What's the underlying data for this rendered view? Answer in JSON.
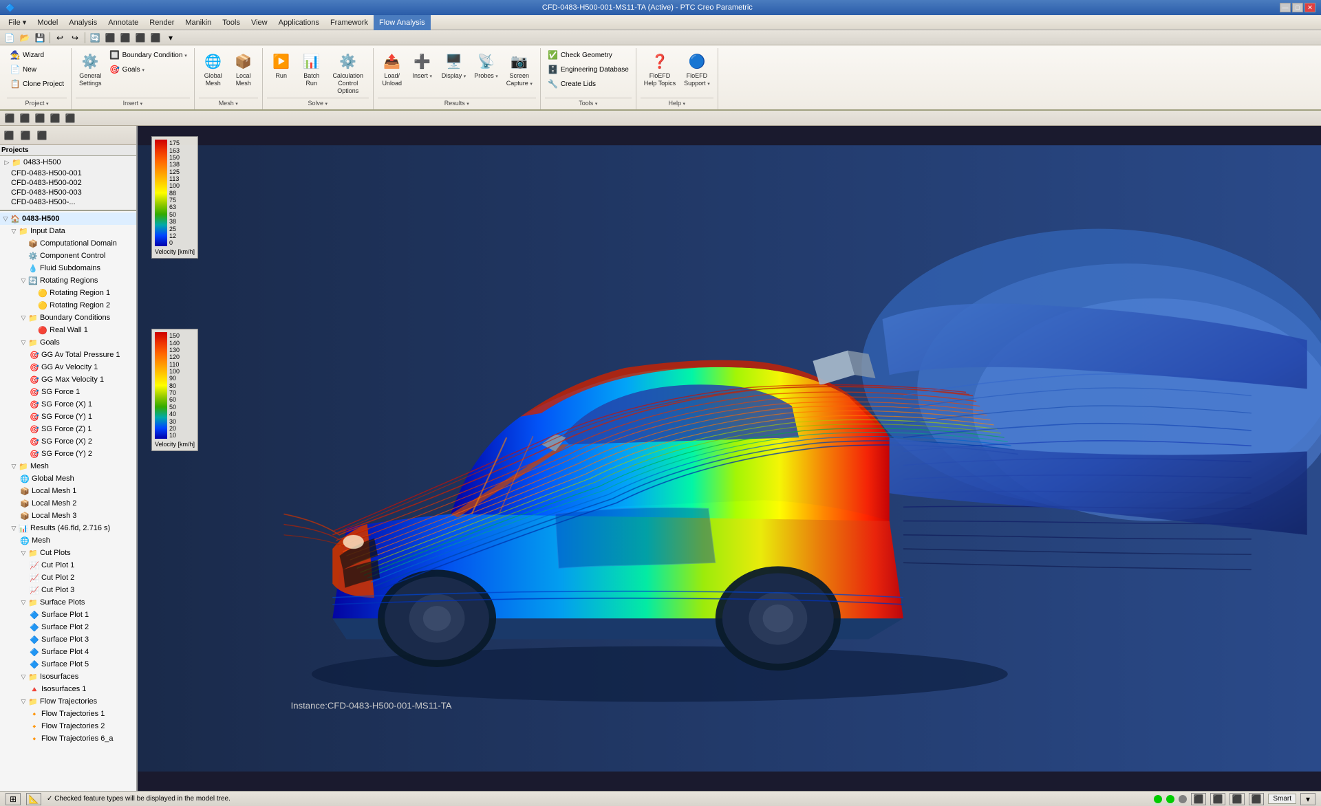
{
  "titlebar": {
    "title": "CFD-0483-H500-001-MS11-TA (Active) - PTC Creo Parametric",
    "min": "—",
    "max": "□",
    "close": "✕"
  },
  "menubar": {
    "items": [
      "File ▾",
      "Model",
      "Analysis",
      "Annotate",
      "Render",
      "Manikin",
      "Tools",
      "View",
      "Applications",
      "Framework",
      "Flow Analysis"
    ]
  },
  "ribbon": {
    "active_tab": "Flow Analysis",
    "tabs": [
      "File ▾",
      "Model",
      "Analysis",
      "Annotate",
      "Render",
      "Manikin",
      "Tools",
      "View",
      "Applications",
      "Framework",
      "Flow Analysis"
    ],
    "groups": [
      {
        "label": "Project ▾",
        "items": [
          {
            "icon": "🧙",
            "label": "Wizard"
          },
          {
            "icon": "📄",
            "label": "New"
          },
          {
            "icon": "📋",
            "label": "Clone Project"
          }
        ]
      },
      {
        "label": "Insert ▾",
        "items": [
          {
            "icon": "⚙️",
            "label": "General\nSettings"
          },
          {
            "icon": "🔲",
            "label": "Boundary\nCondition ▾"
          },
          {
            "icon": "🎯",
            "label": "Goals ▾"
          }
        ]
      },
      {
        "label": "Mesh ▾",
        "items": [
          {
            "icon": "🌐",
            "label": "Global\nMesh"
          },
          {
            "icon": "📦",
            "label": "Local\nMesh"
          }
        ]
      },
      {
        "label": "Solve ▾",
        "items": [
          {
            "icon": "▶️",
            "label": "Run"
          },
          {
            "icon": "📊",
            "label": "Batch\nRun"
          },
          {
            "icon": "⚙️",
            "label": "Calculation\nControl Options"
          }
        ]
      },
      {
        "label": "Results ▾",
        "items": [
          {
            "icon": "📤",
            "label": "Load/\nUnload"
          },
          {
            "icon": "➕",
            "label": "Insert ▾"
          },
          {
            "icon": "🖥️",
            "label": "Display ▾"
          },
          {
            "icon": "📡",
            "label": "Probes ▾"
          },
          {
            "icon": "📷",
            "label": "Screen\nCapture ▾"
          }
        ]
      },
      {
        "label": "Tools ▾",
        "items_col1": [
          {
            "icon": "✅",
            "label": "Check Geometry"
          },
          {
            "icon": "🗄️",
            "label": "Engineering Database"
          },
          {
            "icon": "🔧",
            "label": "Create Lids"
          }
        ]
      },
      {
        "label": "Help ▾",
        "items": [
          {
            "icon": "❓",
            "label": "FloEFD\nHelp Topics"
          },
          {
            "icon": "🔵",
            "label": "FloEFD\nSupport ▾"
          }
        ]
      }
    ]
  },
  "quick_access": {
    "buttons": [
      "📄",
      "📂",
      "💾",
      "↩",
      "↪",
      "🔄",
      "⬜",
      "✕"
    ]
  },
  "secondary_toolbar": {
    "buttons": [
      "⬜",
      "⬜",
      "⬜",
      "⬜",
      "⬜"
    ]
  },
  "bottom_tabs": {
    "tabs": [
      "Project ▾",
      "Insert ▾",
      "Mesh ▾",
      "Solve ▾",
      "Results ▾",
      "Tools ▾",
      "Help ▾"
    ]
  },
  "tree": {
    "title": "Projects",
    "toolbar_buttons": [
      "⬜",
      "⬜",
      "⬜",
      "⬜"
    ],
    "projects": [
      {
        "label": "0483-H500",
        "level": 1
      },
      {
        "label": "CFD-0483-H500-001",
        "level": 2
      },
      {
        "label": "CFD-0483-H500-002",
        "level": 2
      },
      {
        "label": "CFD-0483-H500-003",
        "level": 2
      },
      {
        "label": "CFD-0483-H500-...",
        "level": 2
      }
    ],
    "active_project": "0483-H500",
    "nodes": [
      {
        "label": "0483-H500",
        "level": 0,
        "expanded": true,
        "icon": "🏠"
      },
      {
        "label": "Input Data",
        "level": 1,
        "expanded": true,
        "icon": "📁"
      },
      {
        "label": "Computational Domain",
        "level": 2,
        "icon": "📦"
      },
      {
        "label": "Component Control",
        "level": 2,
        "icon": "⚙️"
      },
      {
        "label": "Fluid Subdomains",
        "level": 2,
        "icon": "💧"
      },
      {
        "label": "Rotating Regions",
        "level": 2,
        "expanded": true,
        "icon": "🔄"
      },
      {
        "label": "Rotating Region 1",
        "level": 3,
        "icon": "🟡"
      },
      {
        "label": "Rotating Region 2",
        "level": 3,
        "icon": "🟡"
      },
      {
        "label": "Boundary Conditions",
        "level": 2,
        "expanded": true,
        "icon": "📁"
      },
      {
        "label": "Real Wall 1",
        "level": 3,
        "icon": "🔴"
      },
      {
        "label": "Goals",
        "level": 2,
        "expanded": true,
        "icon": "📁"
      },
      {
        "label": "GG Av Total Pressure 1",
        "level": 3,
        "icon": "🎯"
      },
      {
        "label": "GG Av Velocity 1",
        "level": 3,
        "icon": "🎯"
      },
      {
        "label": "GG Max Velocity 1",
        "level": 3,
        "icon": "🎯"
      },
      {
        "label": "SG Force 1",
        "level": 3,
        "icon": "🎯"
      },
      {
        "label": "SG Force (X) 1",
        "level": 3,
        "icon": "🎯"
      },
      {
        "label": "SG Force (Y) 1",
        "level": 3,
        "icon": "🎯"
      },
      {
        "label": "SG Force (Z) 1",
        "level": 3,
        "icon": "🎯"
      },
      {
        "label": "SG Force (X) 2",
        "level": 3,
        "icon": "🎯"
      },
      {
        "label": "SG Force (Y) 2",
        "level": 3,
        "icon": "🎯"
      },
      {
        "label": "Mesh",
        "level": 1,
        "expanded": true,
        "icon": "📁"
      },
      {
        "label": "Global Mesh",
        "level": 2,
        "icon": "🌐"
      },
      {
        "label": "Local Mesh 1",
        "level": 2,
        "icon": "📦"
      },
      {
        "label": "Local Mesh 2",
        "level": 2,
        "icon": "📦"
      },
      {
        "label": "Local Mesh 3",
        "level": 2,
        "icon": "📦"
      },
      {
        "label": "Results (46.fld, 2.716 s)",
        "level": 1,
        "expanded": true,
        "icon": "📊"
      },
      {
        "label": "Mesh",
        "level": 2,
        "icon": "🌐"
      },
      {
        "label": "Cut Plots",
        "level": 2,
        "expanded": true,
        "icon": "📁"
      },
      {
        "label": "Cut Plot 1",
        "level": 3,
        "icon": "📈"
      },
      {
        "label": "Cut Plot 2",
        "level": 3,
        "icon": "📈"
      },
      {
        "label": "Cut Plot 3",
        "level": 3,
        "icon": "📈"
      },
      {
        "label": "Surface Plots",
        "level": 2,
        "expanded": true,
        "icon": "📁"
      },
      {
        "label": "Surface Plot 1",
        "level": 3,
        "icon": "🔷"
      },
      {
        "label": "Surface Plot 2",
        "level": 3,
        "icon": "🔷"
      },
      {
        "label": "Surface Plot 3",
        "level": 3,
        "icon": "🔷"
      },
      {
        "label": "Surface Plot 4",
        "level": 3,
        "icon": "🔷"
      },
      {
        "label": "Surface Plot 5",
        "level": 3,
        "icon": "🔷"
      },
      {
        "label": "Isosurfaces",
        "level": 2,
        "expanded": true,
        "icon": "📁"
      },
      {
        "label": "Isosurfaces 1",
        "level": 3,
        "icon": "🔺"
      },
      {
        "label": "Flow Trajectories",
        "level": 2,
        "expanded": true,
        "icon": "📁"
      },
      {
        "label": "Flow Trajectories 1",
        "level": 3,
        "icon": "🔸"
      },
      {
        "label": "Flow Trajectories 2",
        "level": 3,
        "icon": "🔸"
      },
      {
        "label": "Flow Trajectories 6_a",
        "level": 3,
        "icon": "🔸"
      }
    ]
  },
  "legends": {
    "top": {
      "values": [
        "175",
        "163",
        "150",
        "138",
        "125",
        "113",
        "100",
        "88",
        "75",
        "63",
        "50",
        "38",
        "25",
        "12",
        "0"
      ],
      "unit": "Velocity [km/h]"
    },
    "bottom": {
      "values": [
        "150",
        "140",
        "130",
        "120",
        "110",
        "100",
        "90",
        "80",
        "70",
        "60",
        "50",
        "40",
        "30",
        "20",
        "10"
      ],
      "unit": "Velocity [km/h]"
    }
  },
  "viewport": {
    "instance_label": "Instance:CFD-0483-H500-001-MS11-TA",
    "background": "#1a2a4a"
  },
  "statusbar": {
    "message": "✓ Checked feature types will be displayed in the model tree.",
    "smart_label": "Smart",
    "icons": [
      "⊞",
      "📐"
    ]
  }
}
